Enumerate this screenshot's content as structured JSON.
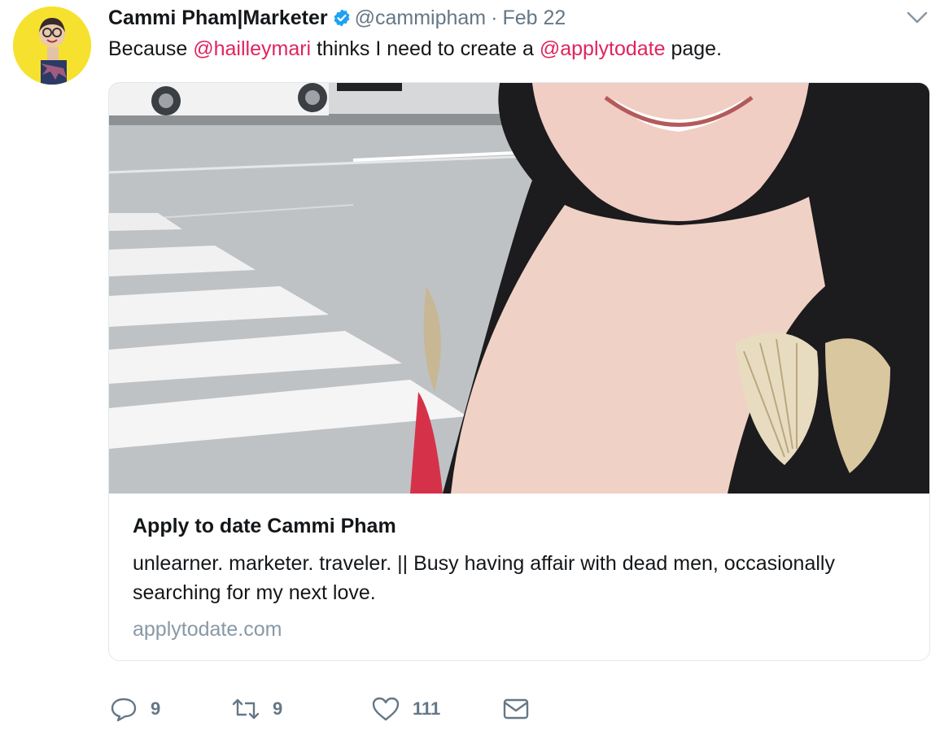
{
  "tweet": {
    "author": {
      "name": "Cammi Pham|Marketer",
      "handle": "@cammipham",
      "verified_icon": "verified-badge-icon",
      "avatar_icon": "avatar"
    },
    "separator": "·",
    "date": "Feb 22",
    "text_parts": {
      "before": "Because ",
      "mention1": "@hailleymari",
      "middle": " thinks I need to create a ",
      "mention2": "@applytodate",
      "after": " page."
    },
    "card": {
      "title": "Apply to date Cammi Pham",
      "description": "unlearner. marketer. traveler. || Busy having affair with dead men, occasionally searching for my next love.",
      "domain": "applytodate.com"
    },
    "actions": {
      "reply_count": "9",
      "retweet_count": "9",
      "like_count": "111"
    }
  },
  "colors": {
    "mention": "#e0245e",
    "secondary_text": "#657786",
    "verified": "#1da1f2",
    "avatar_bg": "#f6e22e"
  }
}
